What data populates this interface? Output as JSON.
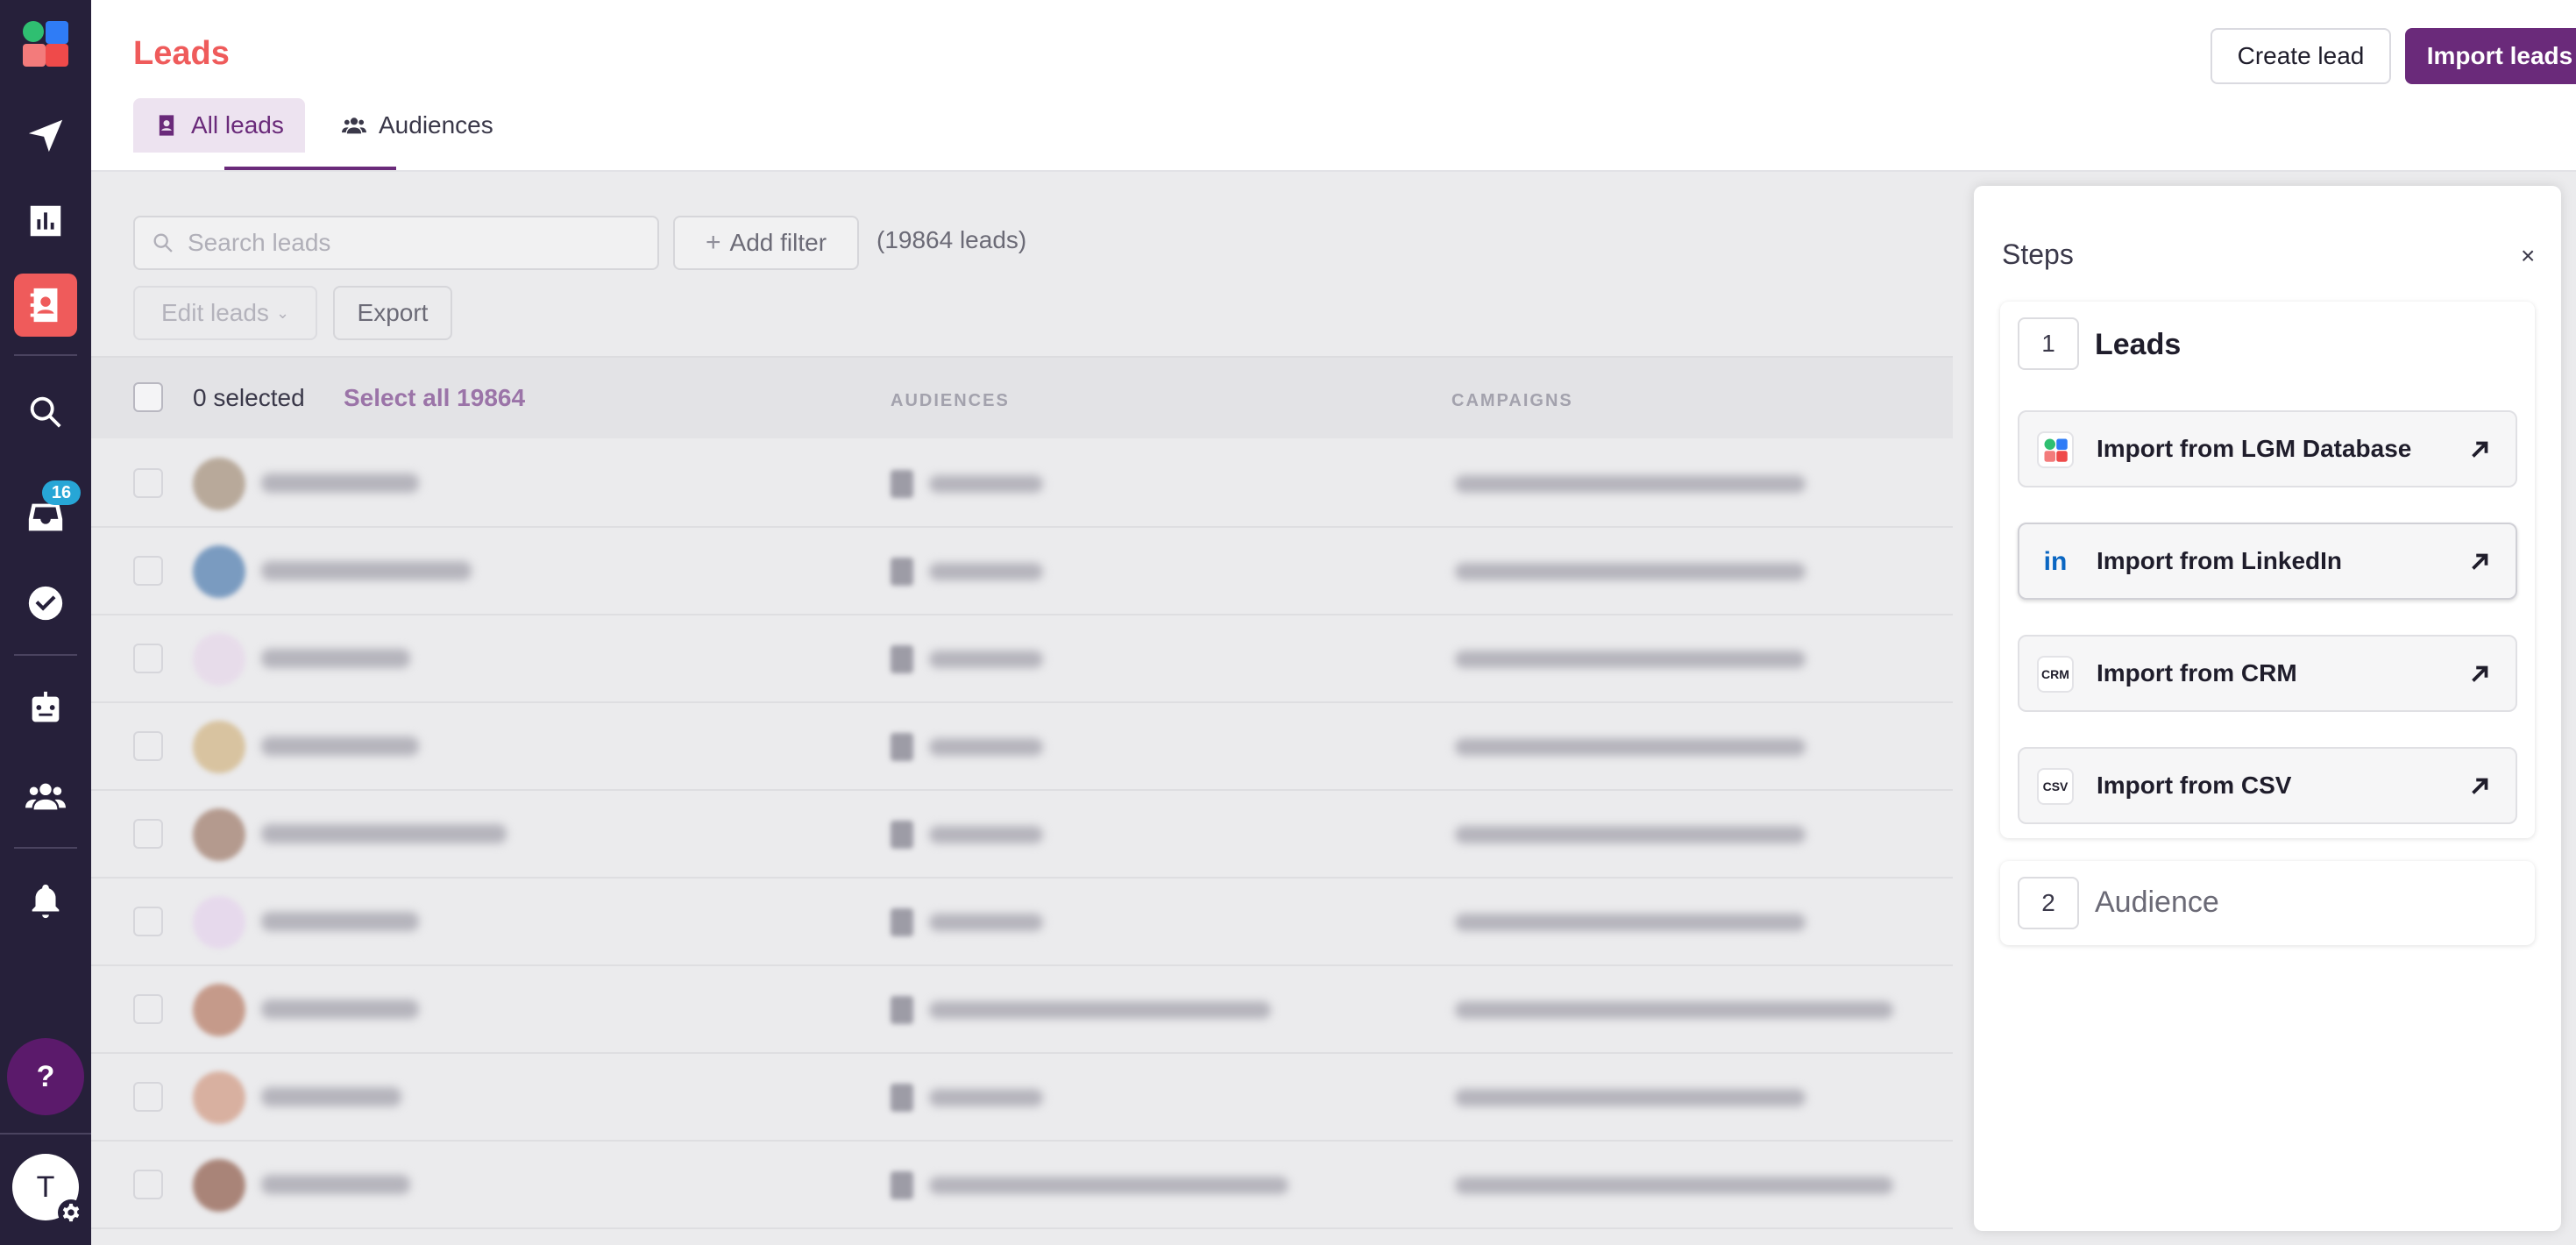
{
  "header": {
    "title": "Leads",
    "tabs": [
      {
        "label": "All leads",
        "icon": "contact-book-icon",
        "active": true
      },
      {
        "label": "Audiences",
        "icon": "people-icon",
        "active": false
      }
    ],
    "create_lead_label": "Create lead",
    "import_leads_label": "Import leads"
  },
  "sidebar": {
    "inbox_badge": "16",
    "help_label": "?",
    "avatar_initial": "T"
  },
  "toolbar": {
    "search_placeholder": "Search leads",
    "add_filter_label": "Add filter",
    "lead_count": "(19864 leads)",
    "edit_leads_label": "Edit leads",
    "export_label": "Export"
  },
  "table": {
    "selected_text": "0 selected",
    "select_all_label": "Select all 19864",
    "columns": [
      "AUDIENCES",
      "CAMPAIGNS"
    ]
  },
  "steps_panel": {
    "title": "Steps",
    "close_label": "×",
    "step1": {
      "number": "1",
      "title": "Leads",
      "options": [
        {
          "label": "Import from LGM Database",
          "icon": "lgm-logo-icon"
        },
        {
          "label": "Import from LinkedIn",
          "icon": "linkedin-icon",
          "icon_text": "in"
        },
        {
          "label": "Import from CRM",
          "icon": "crm-icon",
          "icon_text": "CRM"
        },
        {
          "label": "Import from CSV",
          "icon": "csv-icon",
          "icon_text": "CSV"
        }
      ]
    },
    "step2": {
      "number": "2",
      "title": "Audience"
    }
  },
  "colors": {
    "sidebar_bg": "#26203a",
    "accent_red": "#ef5b5b",
    "accent_purple": "#6a2a7a",
    "badge_blue": "#27a6d6",
    "linkedin_blue": "#0a66c2"
  }
}
